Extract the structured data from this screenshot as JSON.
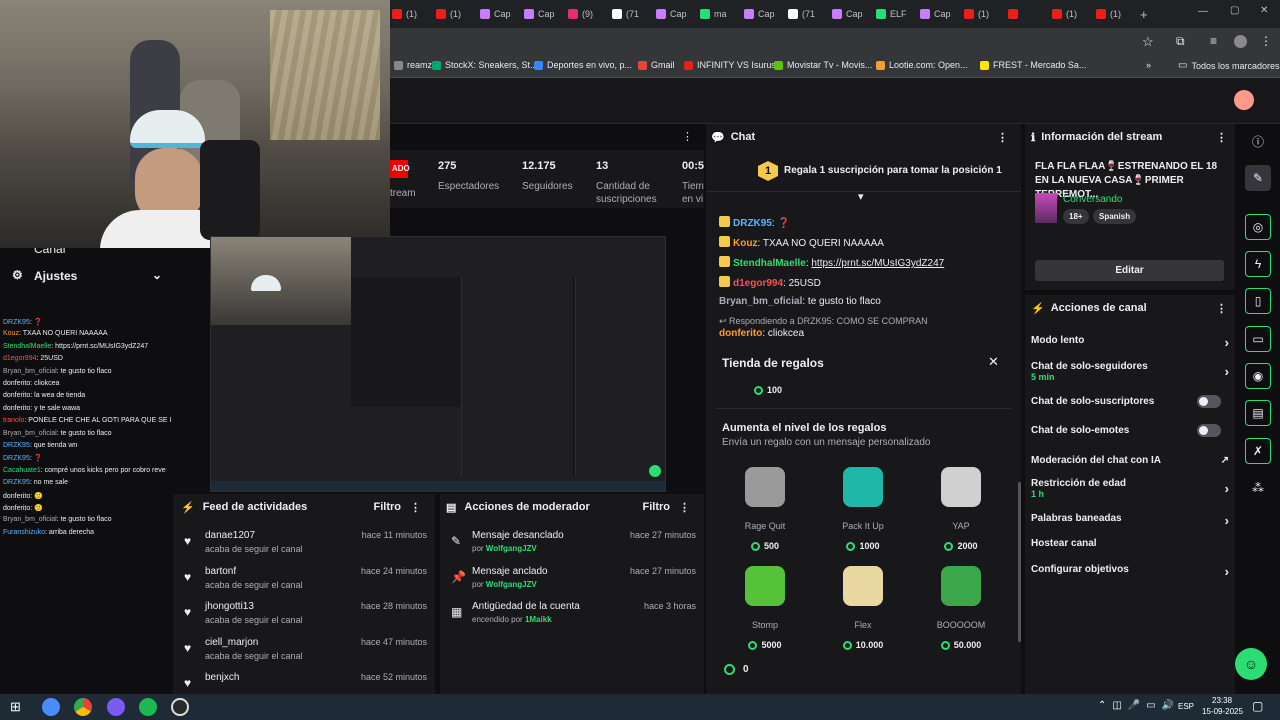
{
  "browser": {
    "tabs": [
      {
        "label": "(1)",
        "color": "#e62117"
      },
      {
        "label": "(1)",
        "color": "#e62117"
      },
      {
        "label": "Cap",
        "color": "#c77dff"
      },
      {
        "label": "Cap",
        "color": "#c77dff"
      },
      {
        "label": "(9)",
        "color": "#e1306c"
      },
      {
        "label": "(71",
        "color": "#ffffff"
      },
      {
        "label": "Cap",
        "color": "#c77dff"
      },
      {
        "label": "ma",
        "color": "#2bde73"
      },
      {
        "label": "Cap",
        "color": "#c77dff"
      },
      {
        "label": "(71",
        "color": "#ffffff"
      },
      {
        "label": "Cap",
        "color": "#c77dff"
      },
      {
        "label": "ELF",
        "color": "#2bde73"
      },
      {
        "label": "Cap",
        "color": "#c77dff"
      },
      {
        "label": "(1)",
        "color": "#e62117"
      },
      {
        "label": "",
        "color": "#e62117"
      },
      {
        "label": "(1)",
        "color": "#e62117"
      },
      {
        "label": "(1)",
        "color": "#e62117"
      }
    ],
    "new_tab": "+",
    "bookmarks": [
      {
        "label": "reamz...",
        "color": "#888888"
      },
      {
        "label": "StockX: Sneakers, St...",
        "color": "#00a86b"
      },
      {
        "label": "Deportes en vivo, p...",
        "color": "#3b82f6"
      },
      {
        "label": "Gmail",
        "color": "#ea4335"
      },
      {
        "label": "INFINITY VS Isurus",
        "color": "#e62117"
      },
      {
        "label": "Movistar Tv - Movis...",
        "color": "#5bc500"
      },
      {
        "label": "Lootie.com: Open...",
        "color": "#f0a030"
      },
      {
        "label": "FREST - Mercado Sa...",
        "color": "#ffe600"
      }
    ],
    "all_bookmarks": "Todos los marcadores",
    "more": "»"
  },
  "leftnav": {
    "settings": "Ajustes",
    "canal": "Canal"
  },
  "stream_chat": [
    {
      "user": "DRZK95",
      "msg": ": ❓",
      "color": "#5ab4ff"
    },
    {
      "user": "Kouz",
      "msg": ": TXAA NO QUERI NAAAAA",
      "color": "#ff9f1c"
    },
    {
      "user": "StendhalMaelle",
      "msg": ": https://prnt.sc/MUsIG3ydZ247",
      "color": "#2bde73"
    },
    {
      "user": "d1egor994",
      "msg": ": 25USD",
      "color": "#ff4f4f"
    },
    {
      "user": "Bryan_bm_oficial",
      "msg": ": te gusto tio flaco",
      "color": "#adadb8"
    },
    {
      "user": "donferito",
      "msg": ": cliokcea",
      "color": "#efeff1"
    },
    {
      "user": "donferito",
      "msg": ": la wea de tienda",
      "color": "#efeff1"
    },
    {
      "user": "donferito",
      "msg": ": y te sale wawa",
      "color": "#efeff1"
    },
    {
      "user": "tranolo",
      "msg": ": PONELE CHE CHE AL GOTI PARA QUE SE I",
      "color": "#ff4f4f"
    },
    {
      "user": "Bryan_bm_oficial",
      "msg": ": te gusto tio flaco",
      "color": "#adadb8"
    },
    {
      "user": "DRZK95",
      "msg": ": que tienda wn",
      "color": "#5ab4ff"
    },
    {
      "user": "DRZK95",
      "msg": ": ❓",
      "color": "#5ab4ff"
    },
    {
      "user": "Cacahuate1",
      "msg": ": compré unos kicks pero por cobro reve",
      "color": "#2bde73"
    },
    {
      "user": "DRZK95",
      "msg": ": no me sale",
      "color": "#5ab4ff"
    },
    {
      "user": "donferito",
      "msg": ": 🙂",
      "color": "#efeff1"
    },
    {
      "user": "donferito",
      "msg": ": 🙂",
      "color": "#efeff1"
    },
    {
      "user": "Bryan_bm_oficial",
      "msg": ": te gusto tio flaco",
      "color": "#adadb8"
    },
    {
      "user": "Furanshizuko",
      "msg": ": arriba derecha",
      "color": "#5ab4ff"
    }
  ],
  "stats": {
    "live": "ADO",
    "stream": "tream",
    "viewers": {
      "value": "275",
      "label": "Espectadores"
    },
    "followers": {
      "value": "12.175",
      "label": "Seguidores"
    },
    "subs": {
      "value": "13",
      "label": "Cantidad de suscripciones"
    },
    "time": {
      "value": "00:5",
      "label": "Tiem en vi"
    }
  },
  "feed": {
    "title": "Feed de actividades",
    "filter": "Filtro",
    "items": [
      {
        "name": "danae1207",
        "sub": "acaba de seguir el canal",
        "time": "hace 11 minutos"
      },
      {
        "name": "bartonf",
        "sub": "acaba de seguir el canal",
        "time": "hace 24 minutos"
      },
      {
        "name": "jhongotti13",
        "sub": "acaba de seguir el canal",
        "time": "hace 28 minutos"
      },
      {
        "name": "ciell_marjon",
        "sub": "acaba de seguir el canal",
        "time": "hace 47 minutos"
      },
      {
        "name": "benjxch",
        "sub": "",
        "time": "hace 52 minutos"
      }
    ]
  },
  "modactions": {
    "title": "Acciones de moderador",
    "filter": "Filtro",
    "items": [
      {
        "title": "Mensaje desanclado",
        "prefix": "por ",
        "user": "WolfgangJZV",
        "time": "hace 27 minutos",
        "icon": "✎"
      },
      {
        "title": "Mensaje anclado",
        "prefix": "por ",
        "user": "WolfgangJZV",
        "time": "hace 27 minutos",
        "icon": "📌"
      },
      {
        "title": "Antigüedad de la cuenta",
        "prefix": "encendido por ",
        "user": "1Maikk",
        "time": "hace 3 horas",
        "icon": "▦"
      }
    ]
  },
  "chat": {
    "title": "Chat",
    "pinned_rank": "1",
    "pinned": "Regala 1 suscripción para tomar la posición 1",
    "lines": [
      {
        "user": "DRZK95",
        "msg": ": ❓",
        "color": "#5ab4ff"
      },
      {
        "user": "Kouz",
        "msg": ": TXAA NO QUERI NAAAAA",
        "color": "#ff9f1c"
      },
      {
        "user": "StendhalMaelle",
        "msg": ": ",
        "link": "https://prnt.sc/MUsIG3ydZ247",
        "color": "#2bde73"
      },
      {
        "user": "d1egor994",
        "msg": ": 25USD",
        "color": "#ff4f4f"
      },
      {
        "user": "Bryan_bm_oficial",
        "msg": ": te gusto tio flaco",
        "color": "#adadb8"
      }
    ],
    "reply": "Respondiendo a DRZK95: COMO SE COMPRAN",
    "reply_user": "donferito",
    "reply_msg": ": cliokcea"
  },
  "gift_store": {
    "title": "Tienda de regalos",
    "top_price": "100",
    "heading": "Aumenta el nivel de los regalos",
    "sub": "Envía un regalo con un mensaje personalizado",
    "gifts": [
      {
        "name": "Rage Quit",
        "price": "500",
        "color": "#9a9a9a"
      },
      {
        "name": "Pack It Up",
        "price": "1000",
        "color": "#1fb8a8"
      },
      {
        "name": "YAP",
        "price": "2000",
        "color": "#d0d0d0"
      },
      {
        "name": "Stomp",
        "price": "5000",
        "color": "#56c23a"
      },
      {
        "name": "Flex",
        "price": "10.000",
        "color": "#e9d7a2"
      },
      {
        "name": "BOOOOOM",
        "price": "50.000",
        "color": "#3aa84a"
      }
    ],
    "balance": "0"
  },
  "stream_info": {
    "header": "Información del stream",
    "title": "FLA FLA FLAA🍷ESTRENANDO EL 18 EN LA NUEVA CASA🍷PRIMER TERREMOT...",
    "category": "Conversando",
    "tags": [
      "18+",
      "Spanish"
    ],
    "edit": "Editar"
  },
  "channel_actions": {
    "header": "Acciones de canal",
    "items": [
      {
        "label": "Modo lento",
        "sub": "",
        "ctrl": "chevron"
      },
      {
        "label": "Chat de solo-seguidores",
        "sub": "5 min",
        "ctrl": "chevron"
      },
      {
        "label": "Chat de solo-suscriptores",
        "sub": "",
        "ctrl": "toggle"
      },
      {
        "label": "Chat de solo-emotes",
        "sub": "",
        "ctrl": "toggle"
      },
      {
        "label": "Moderación del chat con IA",
        "sub": "",
        "ctrl": "external"
      },
      {
        "label": "Restricción de edad",
        "sub": "1 h",
        "ctrl": "chevron"
      },
      {
        "label": "Palabras baneadas",
        "sub": "",
        "ctrl": "chevron"
      },
      {
        "label": "Hostear canal",
        "sub": "",
        "ctrl": "none"
      },
      {
        "label": "Configurar objetivos",
        "sub": "",
        "ctrl": "chevron"
      }
    ]
  },
  "taskbar": {
    "lang": "ESP",
    "time": "23:38",
    "date": "15-09-2025"
  }
}
